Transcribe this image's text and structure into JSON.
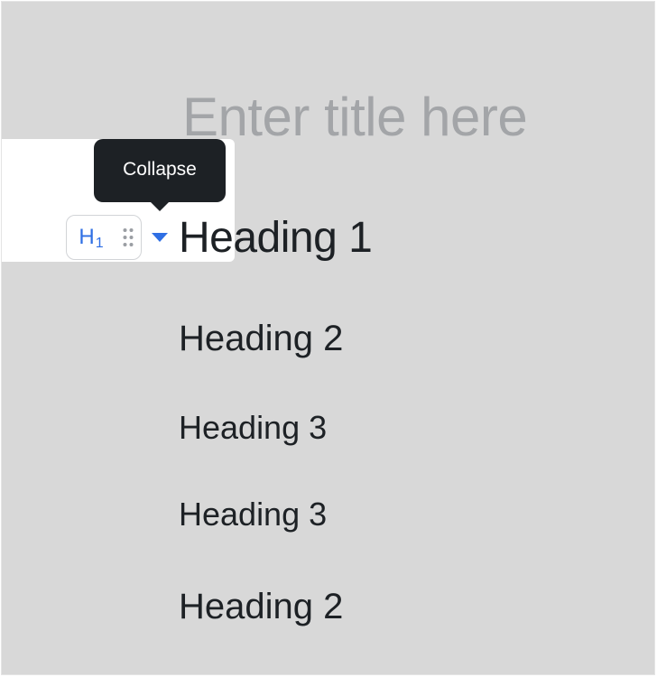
{
  "editor": {
    "title_placeholder": "Enter title here"
  },
  "block_toolbar": {
    "heading_type_letter": "H",
    "heading_type_level": "1",
    "heading_type_icon": "h1-icon",
    "drag_icon": "drag-handle-icon",
    "collapse_icon": "caret-down-icon",
    "accent_color": "#2f6fe4"
  },
  "tooltip": {
    "text": "Collapse"
  },
  "blocks": [
    {
      "level": "h1",
      "text": "Heading 1"
    },
    {
      "level": "h2",
      "text": "Heading 2"
    },
    {
      "level": "h3",
      "text": "Heading 3"
    },
    {
      "level": "h3",
      "text": "Heading 3"
    },
    {
      "level": "h2",
      "text": "Heading 2"
    }
  ]
}
